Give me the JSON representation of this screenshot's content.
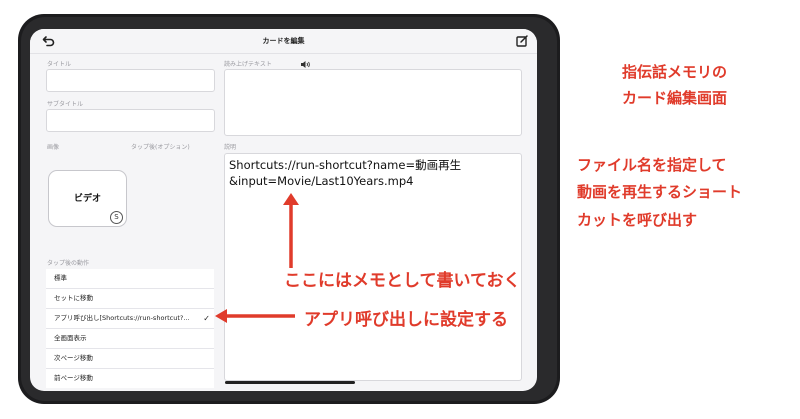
{
  "app": {
    "title": "カードを編集"
  },
  "left_panel": {
    "title_label": "タイトル",
    "subtitle_label": "サブタイトル",
    "image_label": "画像",
    "tap_after_option_label": "タップ後(オプション)",
    "tile_label": "ビデオ",
    "tile_badge": "S",
    "action_section_label": "タップ後の動作",
    "actions": [
      {
        "label": "標準",
        "selected": false
      },
      {
        "label": "セットに移動",
        "selected": false
      },
      {
        "label": "アプリ呼び出し[Shortcuts://run-shortcut?...",
        "selected": true
      },
      {
        "label": "全画面表示",
        "selected": false
      },
      {
        "label": "次ページ移動",
        "selected": false
      },
      {
        "label": "前ページ移動",
        "selected": false
      }
    ],
    "check_mark": "✓"
  },
  "right_panel": {
    "read_text_label": "読み上げテキスト",
    "description_label": "説明",
    "description_value": "Shortcuts://run-shortcut?name=動画再生\n&input=Movie/Last10Years.mp4"
  },
  "annotations": {
    "heading_line1": "指伝話メモリの",
    "heading_line2": "カード編集画面",
    "desc_line1": "ファイル名を指定して",
    "desc_line2": "動画を再生するショート",
    "desc_line3": "カットを呼び出す",
    "memo_note": "ここにはメモとして書いておく",
    "setting_note": "アプリ呼び出しに設定する"
  },
  "colors": {
    "accent_red": "#e03b2b",
    "device_frame": "#1c1c1e",
    "screen_bg": "#f5f5f7"
  },
  "icons": [
    "back-arrow-icon",
    "edit-square-icon",
    "speaker-icon",
    "checkmark-icon",
    "red-arrow-up",
    "red-arrow-left"
  ]
}
